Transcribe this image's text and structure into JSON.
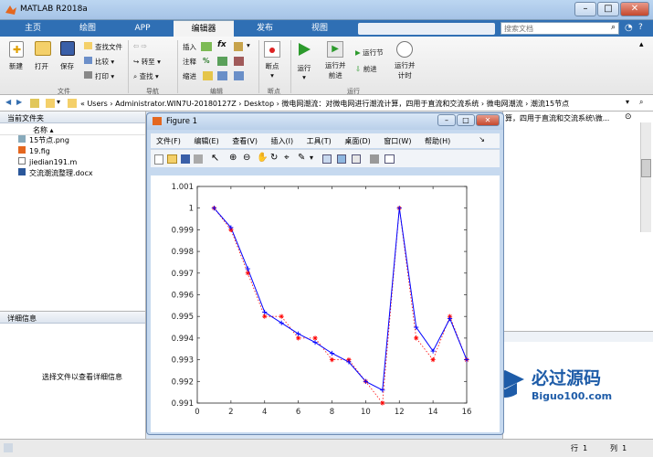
{
  "app": {
    "title": "MATLAB R2018a"
  },
  "tabs": [
    {
      "label": "主页"
    },
    {
      "label": "绘图"
    },
    {
      "label": "APP"
    },
    {
      "label": "编辑器"
    },
    {
      "label": "发布"
    },
    {
      "label": "视图"
    }
  ],
  "search": {
    "placeholder": "搜索文档"
  },
  "ribbon": {
    "file": {
      "new": "新建",
      "open": "打开",
      "save": "保存",
      "find_files": "查找文件",
      "compare": "比较",
      "print": "打印",
      "group": "文件"
    },
    "nav": {
      "goto": "转至",
      "find": "查找",
      "group": "导航"
    },
    "edit": {
      "insert": "插入",
      "fx": "fx",
      "comment": "注释",
      "pct": "%",
      "indent": "缩进",
      "group": "编辑"
    },
    "breakpoints": {
      "label": "断点",
      "group": "断点"
    },
    "run": {
      "run": "运行",
      "run_advance": "运行并\n前进",
      "run_section": "运行节",
      "advance": "前进",
      "run_time": "运行并\n计时",
      "group": "运行"
    }
  },
  "address": {
    "path": "« Users › Administrator.WIN7U-20180127Z › Desktop › 微电网潮流：对微电网进行潮流计算，四用于直流和交流系统 › 微电网潮流 › 潮流15节点"
  },
  "current_folder": {
    "title": "当前文件夹",
    "col_name": "名称",
    "files": [
      "15节点.png",
      "19.fig",
      "jiedian191.m",
      "交流潮流整理.docx"
    ]
  },
  "details": {
    "title": "详细信息",
    "empty_msg": "选择文件以查看详细信息"
  },
  "command_window": {
    "peek_text": "算，四用于直流和交流系统\\微..."
  },
  "status": {
    "row_label": "行",
    "row": "1",
    "col_label": "列",
    "col": "1"
  },
  "figure": {
    "title": "Figure 1",
    "menu": [
      "文件(F)",
      "编辑(E)",
      "查看(V)",
      "插入(I)",
      "工具(T)",
      "桌面(D)",
      "窗口(W)",
      "帮助(H)"
    ]
  },
  "watermark": {
    "cn": "必过源码",
    "url": "Biguo100.com"
  },
  "chart_data": {
    "type": "line",
    "title": "",
    "xlabel": "",
    "ylabel": "",
    "xlim": [
      0,
      16
    ],
    "ylim": [
      0.991,
      1.001
    ],
    "xticks": [
      0,
      2,
      4,
      6,
      8,
      10,
      12,
      14,
      16
    ],
    "yticks": [
      0.991,
      0.992,
      0.993,
      0.994,
      0.995,
      0.996,
      0.997,
      0.998,
      0.999,
      1,
      1.001
    ],
    "ytick_labels": [
      "0.991",
      "0.992",
      "0.993",
      "0.994",
      "0.995",
      "0.996",
      "0.997",
      "0.998",
      "0.999",
      "1",
      "1.001"
    ],
    "grid": false,
    "series": [
      {
        "style": "blue solid line with plus markers",
        "color": "#0000ff",
        "x": [
          1,
          2,
          3,
          4,
          5,
          6,
          7,
          8,
          9,
          10,
          11,
          12,
          13,
          14,
          15,
          16
        ],
        "y": [
          1.0,
          0.9991,
          0.9972,
          0.9952,
          0.9947,
          0.9942,
          0.9938,
          0.9933,
          0.9929,
          0.992,
          0.9916,
          1.0,
          0.9945,
          0.9934,
          0.9949,
          0.993
        ]
      },
      {
        "style": "red dotted line with star markers",
        "color": "#ff0000",
        "x": [
          1,
          2,
          3,
          4,
          5,
          6,
          7,
          8,
          9,
          10,
          11,
          12,
          13,
          14,
          15,
          16
        ],
        "y": [
          1.0,
          0.999,
          0.997,
          0.995,
          0.995,
          0.994,
          0.994,
          0.993,
          0.993,
          0.992,
          0.991,
          1.0,
          0.994,
          0.993,
          0.995,
          0.993
        ]
      }
    ]
  }
}
